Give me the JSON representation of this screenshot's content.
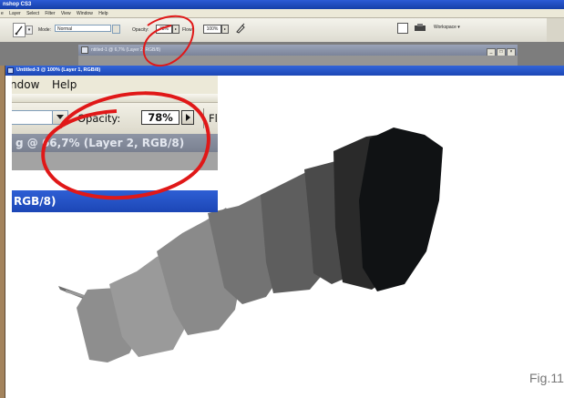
{
  "app": {
    "title": "nshop CS3"
  },
  "menubar": {
    "items": [
      "e",
      "Layer",
      "Select",
      "Filter",
      "View",
      "Window",
      "Help"
    ]
  },
  "options": {
    "mode_label": "Mode:",
    "mode_value": "Normal",
    "opacity_label": "Opacity:",
    "opacity_value": "78%",
    "flow_label": "Flow:",
    "flow_value": "100%",
    "workspace_label": "Workspace ▾"
  },
  "document1": {
    "title": "ntitled-1 @ 6,7% (Layer 2, RGB/8)",
    "buttons": [
      "_",
      "□",
      "×"
    ]
  },
  "document2": {
    "title": "Untitled-3 @ 100% (Layer 1, RGB/8)"
  },
  "inset": {
    "menu_items": [
      "ndow",
      "Help"
    ],
    "opacity_label": "Opacity:",
    "opacity_value": "78%",
    "flow_label": "Flo",
    "doc1_title": "g @ 66,7% (Layer 2, RGB/8)",
    "doc2_title": "RGB/8)"
  },
  "strokes": [
    {
      "color": "#8e8e8e"
    },
    {
      "color": "#9a9a9a"
    },
    {
      "color": "#8a8a8a"
    },
    {
      "color": "#737373"
    },
    {
      "color": "#5e5e5e"
    },
    {
      "color": "#4a4a4a"
    },
    {
      "color": "#2a2a2a"
    },
    {
      "color": "#101214"
    }
  ],
  "caption": "Fig.11",
  "colors": {
    "annotation_red": "#e01818",
    "title_blue": "#2a59cf"
  }
}
